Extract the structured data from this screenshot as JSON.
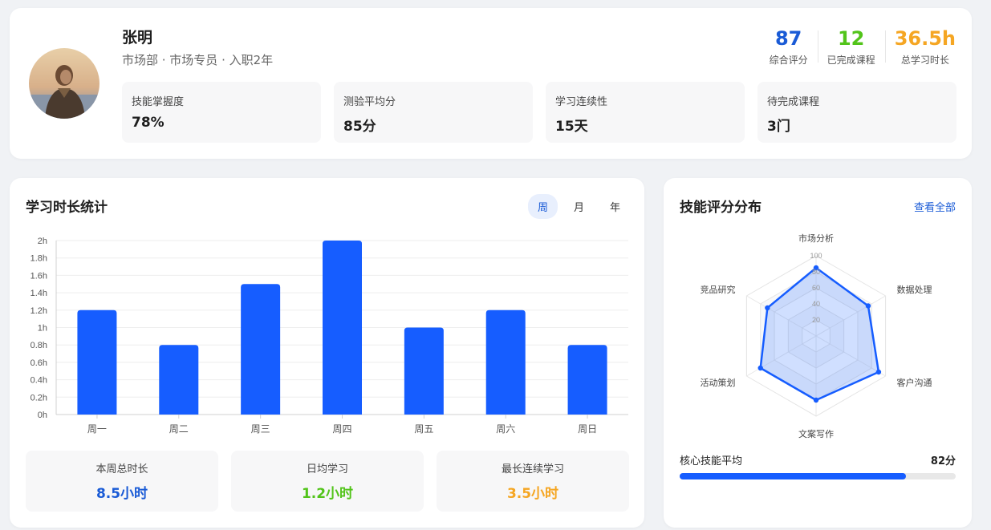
{
  "profile": {
    "name": "张明",
    "subtitle": "市场部 · 市场专员 · 入职2年",
    "stats": [
      {
        "value": "87",
        "label": "综合评分",
        "color": "#1a5bd6"
      },
      {
        "value": "12",
        "label": "已完成课程",
        "color": "#52c41a"
      },
      {
        "value": "36.5h",
        "label": "总学习时长",
        "color": "#f5a623"
      }
    ],
    "metrics": [
      {
        "label": "技能掌握度",
        "value": "78%"
      },
      {
        "label": "测验平均分",
        "value": "85分"
      },
      {
        "label": "学习连续性",
        "value": "15天"
      },
      {
        "label": "待完成课程",
        "value": "3门"
      }
    ]
  },
  "study": {
    "title": "学习时长统计",
    "tabs": [
      {
        "label": "周",
        "active": true
      },
      {
        "label": "月",
        "active": false
      },
      {
        "label": "年",
        "active": false
      }
    ],
    "summary": [
      {
        "label": "本周总时长",
        "value": "8.5小时",
        "color": "#1a5bd6"
      },
      {
        "label": "日均学习",
        "value": "1.2小时",
        "color": "#52c41a"
      },
      {
        "label": "最长连续学习",
        "value": "3.5小时",
        "color": "#f5a623"
      }
    ]
  },
  "skills": {
    "title": "技能评分分布",
    "view_all": "查看全部",
    "core_label": "核心技能平均",
    "core_value": "82分",
    "core_fraction": 0.82
  },
  "chart_data": [
    {
      "type": "bar",
      "categories": [
        "周一",
        "周二",
        "周三",
        "周四",
        "周五",
        "周六",
        "周日"
      ],
      "values": [
        1.2,
        0.8,
        1.5,
        2.0,
        1.0,
        1.2,
        0.8
      ],
      "yticks": [
        "0h",
        "0.2h",
        "0.4h",
        "0.6h",
        "0.8h",
        "1h",
        "1.2h",
        "1.4h",
        "1.6h",
        "1.8h",
        "2h"
      ],
      "ylim": [
        0,
        2
      ],
      "color": "#165dff",
      "grid": true
    },
    {
      "type": "radar",
      "categories": [
        "市场分析",
        "数据处理",
        "客户沟通",
        "文案写作",
        "活动策划",
        "竞品研究"
      ],
      "values": [
        85,
        75,
        90,
        80,
        80,
        70
      ],
      "rticks": [
        "20",
        "40",
        "60",
        "80",
        "100"
      ],
      "rlim": [
        0,
        100
      ],
      "color": "#165dff"
    }
  ]
}
